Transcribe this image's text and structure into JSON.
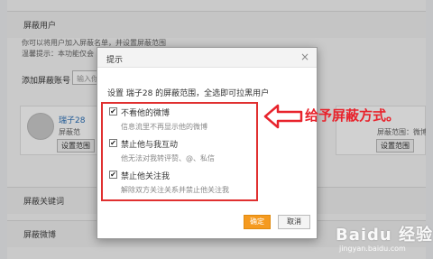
{
  "background": {
    "section_title": "屏蔽用户",
    "intro_line1": "你可以将用户加入屏蔽名单，并设置屏蔽范围",
    "intro_line2": "温馨提示：本功能仅会",
    "add_label": "添加屏蔽账号",
    "add_placeholder": "输入你",
    "card_user_name": "瑞子28",
    "card_scope": "屏蔽范",
    "card_btn": "设置范围",
    "card2_scope": "屏蔽范围：微博、关",
    "card2_btn": "设置范围",
    "section_keywords": "屏蔽关键词",
    "section_weibo": "屏蔽微博"
  },
  "modal": {
    "title": "提示",
    "close": "×",
    "description": "设置 瑞子28 的屏蔽范围，全选即可拉黑用户",
    "options": [
      {
        "label": "不看他的微博",
        "hint": "信息流里不再显示他的微博",
        "checked": true,
        "mark": "✔"
      },
      {
        "label": "禁止他与我互动",
        "hint": "他无法对我转评赞、@、私信",
        "checked": true,
        "mark": "✔"
      },
      {
        "label": "禁止他关注我",
        "hint": "解除双方关注关系并禁止他关注我",
        "checked": true,
        "mark": "✔"
      }
    ],
    "confirm": "确定",
    "cancel": "取消"
  },
  "annotation": {
    "text": "给予屏蔽方式。",
    "color": "#e8232c"
  },
  "watermark": {
    "brand": "Baidu 经验",
    "url": "jingyan.baidu.com"
  }
}
